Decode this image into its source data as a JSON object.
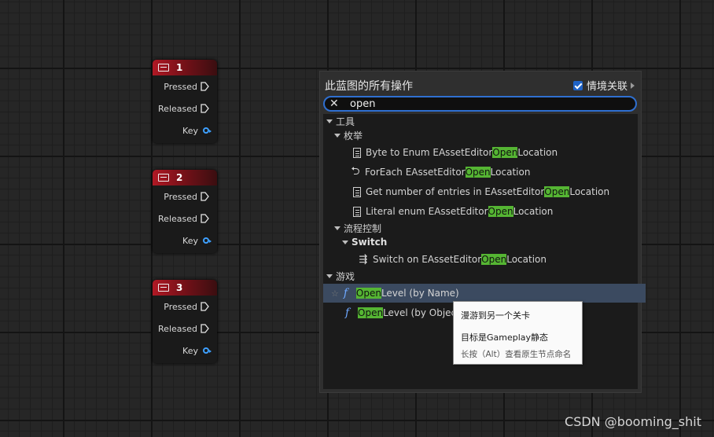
{
  "nodes": [
    {
      "title": "1",
      "pins": [
        "Pressed",
        "Released",
        "Key"
      ]
    },
    {
      "title": "2",
      "pins": [
        "Pressed",
        "Released",
        "Key"
      ]
    },
    {
      "title": "3",
      "pins": [
        "Pressed",
        "Released",
        "Key"
      ]
    }
  ],
  "menu": {
    "title": "此蓝图的所有操作",
    "context_label": "情境关联",
    "context_checked": true,
    "search_value": "open",
    "categories": {
      "tools": "工具",
      "enum": "枚举",
      "flow": "流程控制",
      "switch": "Switch",
      "game": "游戏"
    },
    "items": {
      "byte_to_enum": {
        "pre": "Byte to Enum EAssetEditor",
        "hl": "Open",
        "post": "Location"
      },
      "foreach": {
        "pre": "ForEach EAssetEditor",
        "hl": "Open",
        "post": "Location"
      },
      "get_number": {
        "pre": "Get number of entries in EAssetEditor",
        "hl": "Open",
        "post": "Location"
      },
      "literal_enum": {
        "pre": "Literal enum EAssetEditor",
        "hl": "Open",
        "post": "Location"
      },
      "switch_on": {
        "pre": "Switch on EAssetEditor",
        "hl": "Open",
        "post": "Location"
      },
      "open_level_name": {
        "hl": "Open",
        "post": " Level (by Name)"
      },
      "open_level_object": {
        "hl": "Open",
        "post": " Level (by Objec"
      }
    }
  },
  "tooltip": {
    "line1": "漫游到另一个关卡",
    "line2": "目标是Gameplay静态",
    "line3": "长按（Alt）查看原生节点命名"
  },
  "watermark": "CSDN @booming_shit",
  "colors": {
    "highlight": "#55b533",
    "selection": "#3b4a60",
    "node_header": "#b01824",
    "search_border": "#2f6fd0"
  }
}
